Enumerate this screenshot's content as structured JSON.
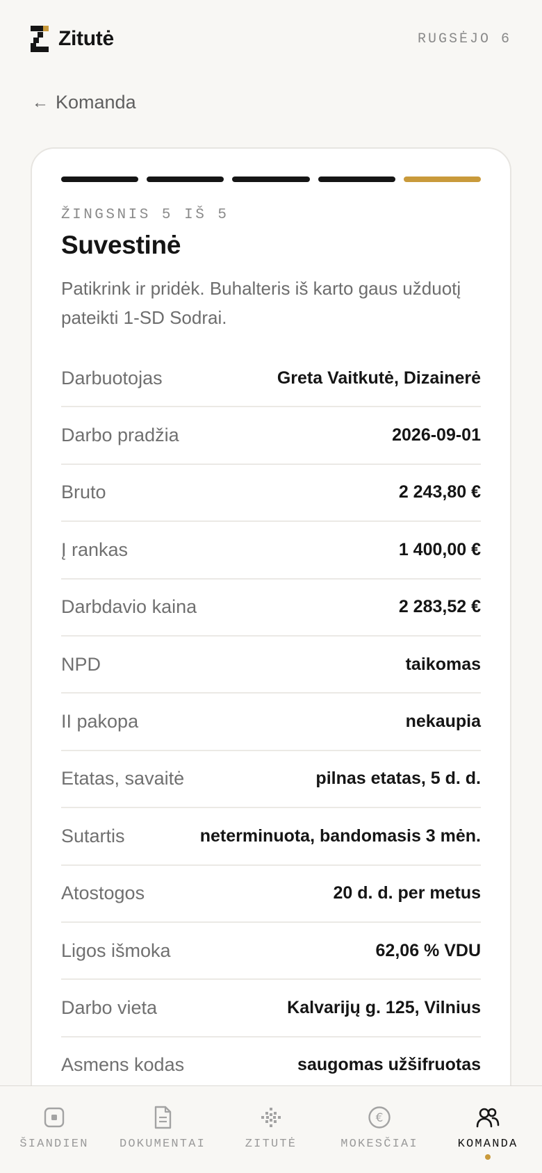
{
  "header": {
    "brand": "Zitutė",
    "date": "RUGSĖJO 6"
  },
  "back": {
    "label": "Komanda"
  },
  "wizard": {
    "total_steps": 5,
    "current_step": 5,
    "step_label": "ŽINGSNIS 5 IŠ 5",
    "title": "Suvestinė",
    "description": "Patikrink ir pridėk. Buhalteris iš karto gaus užduotį pateikti 1-SD Sodrai."
  },
  "summary": [
    {
      "label": "Darbuotojas",
      "value": "Greta Vaitkutė, Dizainerė"
    },
    {
      "label": "Darbo pradžia",
      "value": "2026-09-01"
    },
    {
      "label": "Bruto",
      "value": "2 243,80 €"
    },
    {
      "label": "Į rankas",
      "value": "1 400,00 €"
    },
    {
      "label": "Darbdavio kaina",
      "value": "2 283,52 €"
    },
    {
      "label": "NPD",
      "value": "taikomas"
    },
    {
      "label": "II pakopa",
      "value": "nekaupia"
    },
    {
      "label": "Etatas, savaitė",
      "value": "pilnas etatas, 5 d. d."
    },
    {
      "label": "Sutartis",
      "value": "neterminuota, bandomasis 3 mėn."
    },
    {
      "label": "Atostogos",
      "value": "20 d. d. per metus"
    },
    {
      "label": "Ligos išmoka",
      "value": "62,06 % VDU"
    },
    {
      "label": "Darbo vieta",
      "value": "Kalvarijų g. 125, Vilnius"
    },
    {
      "label": "Asmens kodas",
      "value": "saugomas užšifruotas"
    }
  ],
  "nav": {
    "items": [
      {
        "label": "ŠIANDIEN",
        "icon": "today-icon"
      },
      {
        "label": "DOKUMENTAI",
        "icon": "document-icon"
      },
      {
        "label": "ZITUTĖ",
        "icon": "sparkle-icon"
      },
      {
        "label": "MOKESČIAI",
        "icon": "euro-icon"
      },
      {
        "label": "KOMANDA",
        "icon": "team-icon"
      }
    ],
    "active_index": 4
  },
  "colors": {
    "accent": "#c99a3b",
    "text": "#151515",
    "muted": "#707070",
    "background": "#f8f7f4",
    "card": "#ffffff"
  }
}
